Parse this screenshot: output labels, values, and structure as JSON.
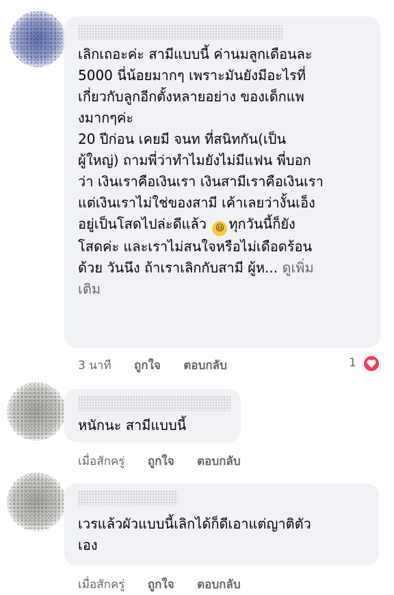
{
  "comments": [
    {
      "author": "",
      "lines": [
        "เลิกเถอะค่ะ สามีแบบนี้ ค่านมลูกเดือนละ",
        "5000 นี่น้อยมากๆ เพราะมันยังมีอะไรที่",
        "เกี่ยวกับลูกอีกตั้งหลายอย่าง ของเด็กแพ",
        "งมากๆค่ะ",
        "20 ปีก่อน เคยมี จนท ที่สนิทกัน(เป็น",
        "ผู้ใหญ่) ถามพี่ว่าทำไมยังไม่มีแฟน พี่บอก",
        "ว่า เงินเราคือเงินเรา เงินสามีเราคือเงินเรา",
        "แต่เงินเราไม่ใช่ของสามี เค้าเลยว่างั้นเอ็ง",
        "อยู่เป็นโสดไปล่ะดีแล้ว",
        "ทุกวันนี้ก็ยัง",
        "โสดค่ะ และเราไม่สนใจหรือไม่เดือดร้อน",
        "ด้วย วันนึง ถ้าเราเลิกกับสามี ผู้ห...",
        "ดูเพิ่ม",
        "เติม"
      ],
      "emoji": "laughing-face-emoji",
      "time": "3 นาที",
      "like_label": "ถูกใจ",
      "reply_label": "ตอบกลับ",
      "reaction_count": "1",
      "reaction_type": "love"
    },
    {
      "author": "",
      "lines": [
        "หนักนะ สามีแบบนี้"
      ],
      "time": "เมื่อสักครู่",
      "like_label": "ถูกใจ",
      "reply_label": "ตอบกลับ"
    },
    {
      "author": "",
      "lines": [
        "เวรแล้วผัวแบบนี้เลิกได้ก็ดีเอาแต่ญาติตัว",
        "เอง"
      ],
      "time": "เมื่อสักครู่",
      "like_label": "ถูกใจ",
      "reply_label": "ตอบกลับ"
    }
  ],
  "colors": {
    "bubble": "#f0f2f5",
    "text": "#050505",
    "secondary": "#65676b",
    "love": "#f33e58"
  }
}
